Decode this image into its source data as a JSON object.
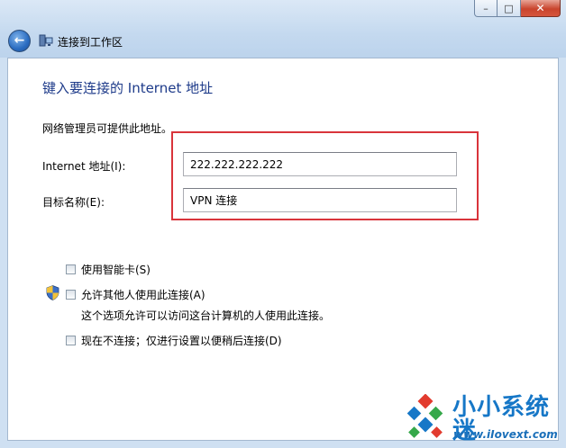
{
  "window": {
    "title": "连接到工作区",
    "caption": {
      "minimize": "–",
      "maximize": "□",
      "close": "✕"
    }
  },
  "nav": {
    "back_icon": "back-arrow-icon",
    "back_glyph": "←"
  },
  "page": {
    "heading": "键入要连接的 Internet 地址",
    "info": "网络管理员可提供此地址。",
    "address_label": "Internet 地址(I):",
    "address_value": "222.222.222.222",
    "dest_label": "目标名称(E):",
    "dest_value": "VPN 连接"
  },
  "options": {
    "smart_card": {
      "label": "使用智能卡(S)",
      "checked": false
    },
    "allow_others": {
      "label": "允许其他人使用此连接(A)",
      "checked": false,
      "description": "这个选项允许可以访问这台计算机的人使用此连接。"
    },
    "no_connect": {
      "label": "现在不连接；仅进行设置以便稍后连接(D)",
      "checked": false
    }
  },
  "watermark": {
    "title": "小小系统迷",
    "url": "www.iIovext.com"
  },
  "colors": {
    "heading": "#1e3b8a",
    "highlight": "#d9343b",
    "watermark": "#1677c7"
  }
}
